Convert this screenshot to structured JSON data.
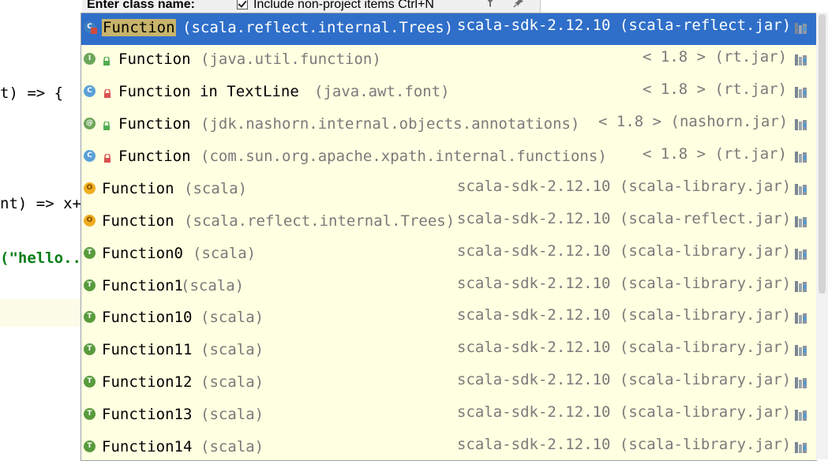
{
  "editor": {
    "lines": [
      {
        "text": "t) => {",
        "string": false
      },
      {
        "text": "nt) => x+",
        "string": false
      },
      {
        "text": "(\"hello..",
        "string": true
      }
    ]
  },
  "header": {
    "label": "Enter class name:",
    "include_label": "Include non-project items Ctrl+N",
    "include_checked": true
  },
  "results": [
    {
      "name": "Function",
      "container": "(scala.reflect.internal.Trees)",
      "library": "scala-sdk-2.12.10 (scala-reflect.jar)",
      "icon": "scala-class-icon",
      "selected": true
    },
    {
      "name": "Function",
      "container": "(java.util.function)",
      "library": "< 1.8 > (rt.jar)",
      "icon": "java-interface-icon",
      "selected": false
    },
    {
      "name": "Function in TextLine",
      "container": "(java.awt.font)",
      "library": "< 1.8 > (rt.jar)",
      "icon": "java-class-icon",
      "selected": false
    },
    {
      "name": "Function",
      "container": "(jdk.nashorn.internal.objects.annotations)",
      "library": "< 1.8 > (nashorn.jar)",
      "icon": "annotation-icon",
      "selected": false
    },
    {
      "name": "Function",
      "container": "(com.sun.org.apache.xpath.internal.functions)",
      "library": "< 1.8 > (rt.jar)",
      "icon": "java-class-icon",
      "selected": false
    },
    {
      "name": "Function",
      "container": "(scala)",
      "library": "scala-sdk-2.12.10 (scala-library.jar)",
      "icon": "scala-object-icon",
      "selected": false
    },
    {
      "name": "Function",
      "container": "(scala.reflect.internal.Trees)",
      "library": "scala-sdk-2.12.10 (scala-reflect.jar)",
      "icon": "scala-object-icon",
      "selected": false
    },
    {
      "name": "Function0",
      "container": "(scala)",
      "library": "scala-sdk-2.12.10 (scala-library.jar)",
      "icon": "scala-trait-icon",
      "selected": false
    },
    {
      "name": "Function1",
      "container": "(scala)",
      "library": "scala-sdk-2.12.10 (scala-library.jar)",
      "icon": "scala-trait-icon",
      "selected": false
    },
    {
      "name": "Function10",
      "container": "(scala)",
      "library": "scala-sdk-2.12.10 (scala-library.jar)",
      "icon": "scala-trait-icon",
      "selected": false
    },
    {
      "name": "Function11",
      "container": "(scala)",
      "library": "scala-sdk-2.12.10 (scala-library.jar)",
      "icon": "scala-trait-icon",
      "selected": false
    },
    {
      "name": "Function12",
      "container": "(scala)",
      "library": "scala-sdk-2.12.10 (scala-library.jar)",
      "icon": "scala-trait-icon",
      "selected": false
    },
    {
      "name": "Function13",
      "container": "(scala)",
      "library": "scala-sdk-2.12.10 (scala-library.jar)",
      "icon": "scala-trait-icon",
      "selected": false
    },
    {
      "name": "Function14",
      "container": "(scala)",
      "library": "scala-sdk-2.12.10 (scala-library.jar)",
      "icon": "scala-trait-icon",
      "selected": false
    }
  ],
  "colors": {
    "selection": "#2f6fc9",
    "popup_background": "#ffffe1",
    "match_highlight": "#c8b46b"
  }
}
